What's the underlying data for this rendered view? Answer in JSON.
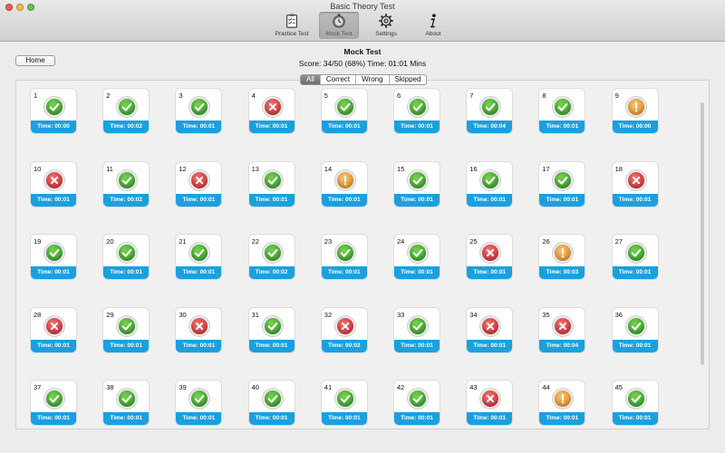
{
  "window": {
    "title": "Basic Theory Test"
  },
  "toolbar": {
    "items": [
      {
        "label": "Practice Test",
        "icon": "clipboard-icon"
      },
      {
        "label": "Mock Test",
        "icon": "clock-icon"
      },
      {
        "label": "Settings",
        "icon": "gear-icon"
      },
      {
        "label": "About",
        "icon": "info-icon"
      }
    ],
    "active_index": 1
  },
  "header": {
    "home_label": "Home",
    "title": "Mock Test",
    "score_text": "Score: 34/50 (68%) Time: 01:01 Mins"
  },
  "filter": {
    "options": [
      "All",
      "Correct",
      "Wrong",
      "Skipped"
    ],
    "selected": "All"
  },
  "colors": {
    "correct": "#2c9428",
    "wrong": "#c9262a",
    "skipped": "#e08716",
    "time_bar": "#1aa0df"
  },
  "questions": [
    {
      "n": "1",
      "status": "correct",
      "time": "Time: 00:00"
    },
    {
      "n": "2",
      "status": "correct",
      "time": "Time: 00:02"
    },
    {
      "n": "3",
      "status": "correct",
      "time": "Time: 00:01"
    },
    {
      "n": "4",
      "status": "wrong",
      "time": "Time: 00:01"
    },
    {
      "n": "5",
      "status": "correct",
      "time": "Time: 00:01"
    },
    {
      "n": "6",
      "status": "correct",
      "time": "Time: 00:01"
    },
    {
      "n": "7",
      "status": "correct",
      "time": "Time: 00:04"
    },
    {
      "n": "8",
      "status": "correct",
      "time": "Time: 00:01"
    },
    {
      "n": "9",
      "status": "skipped",
      "time": "Time: 00:00"
    },
    {
      "n": "10",
      "status": "wrong",
      "time": "Time: 00:01"
    },
    {
      "n": "11",
      "status": "correct",
      "time": "Time: 00:02"
    },
    {
      "n": "12",
      "status": "wrong",
      "time": "Time: 00:01"
    },
    {
      "n": "13",
      "status": "correct",
      "time": "Time: 00:01"
    },
    {
      "n": "14",
      "status": "skipped",
      "time": "Time: 00:01"
    },
    {
      "n": "15",
      "status": "correct",
      "time": "Time: 00:01"
    },
    {
      "n": "16",
      "status": "correct",
      "time": "Time: 00:01"
    },
    {
      "n": "17",
      "status": "correct",
      "time": "Time: 00:01"
    },
    {
      "n": "18",
      "status": "wrong",
      "time": "Time: 00:01"
    },
    {
      "n": "19",
      "status": "correct",
      "time": "Time: 00:01"
    },
    {
      "n": "20",
      "status": "correct",
      "time": "Time: 00:01"
    },
    {
      "n": "21",
      "status": "correct",
      "time": "Time: 00:01"
    },
    {
      "n": "22",
      "status": "correct",
      "time": "Time: 00:02"
    },
    {
      "n": "23",
      "status": "correct",
      "time": "Time: 00:01"
    },
    {
      "n": "24",
      "status": "correct",
      "time": "Time: 00:01"
    },
    {
      "n": "25",
      "status": "wrong",
      "time": "Time: 00:01"
    },
    {
      "n": "26",
      "status": "skipped",
      "time": "Time: 00:03"
    },
    {
      "n": "27",
      "status": "correct",
      "time": "Time: 00:01"
    },
    {
      "n": "28",
      "status": "wrong",
      "time": "Time: 00:01"
    },
    {
      "n": "29",
      "status": "correct",
      "time": "Time: 00:01"
    },
    {
      "n": "30",
      "status": "wrong",
      "time": "Time: 00:01"
    },
    {
      "n": "31",
      "status": "correct",
      "time": "Time: 00:01"
    },
    {
      "n": "32",
      "status": "wrong",
      "time": "Time: 00:02"
    },
    {
      "n": "33",
      "status": "correct",
      "time": "Time: 00:01"
    },
    {
      "n": "34",
      "status": "wrong",
      "time": "Time: 00:01"
    },
    {
      "n": "35",
      "status": "wrong",
      "time": "Time: 00:04"
    },
    {
      "n": "36",
      "status": "correct",
      "time": "Time: 00:01"
    },
    {
      "n": "37",
      "status": "correct",
      "time": "Time: 00:01"
    },
    {
      "n": "38",
      "status": "correct",
      "time": "Time: 00:01"
    },
    {
      "n": "39",
      "status": "correct",
      "time": "Time: 00:01"
    },
    {
      "n": "40",
      "status": "correct",
      "time": "Time: 00:01"
    },
    {
      "n": "41",
      "status": "correct",
      "time": "Time: 00:01"
    },
    {
      "n": "42",
      "status": "correct",
      "time": "Time: 00:01"
    },
    {
      "n": "43",
      "status": "wrong",
      "time": "Time: 00:01"
    },
    {
      "n": "44",
      "status": "skipped",
      "time": "Time: 00:01"
    },
    {
      "n": "45",
      "status": "correct",
      "time": "Time: 00:01"
    }
  ]
}
